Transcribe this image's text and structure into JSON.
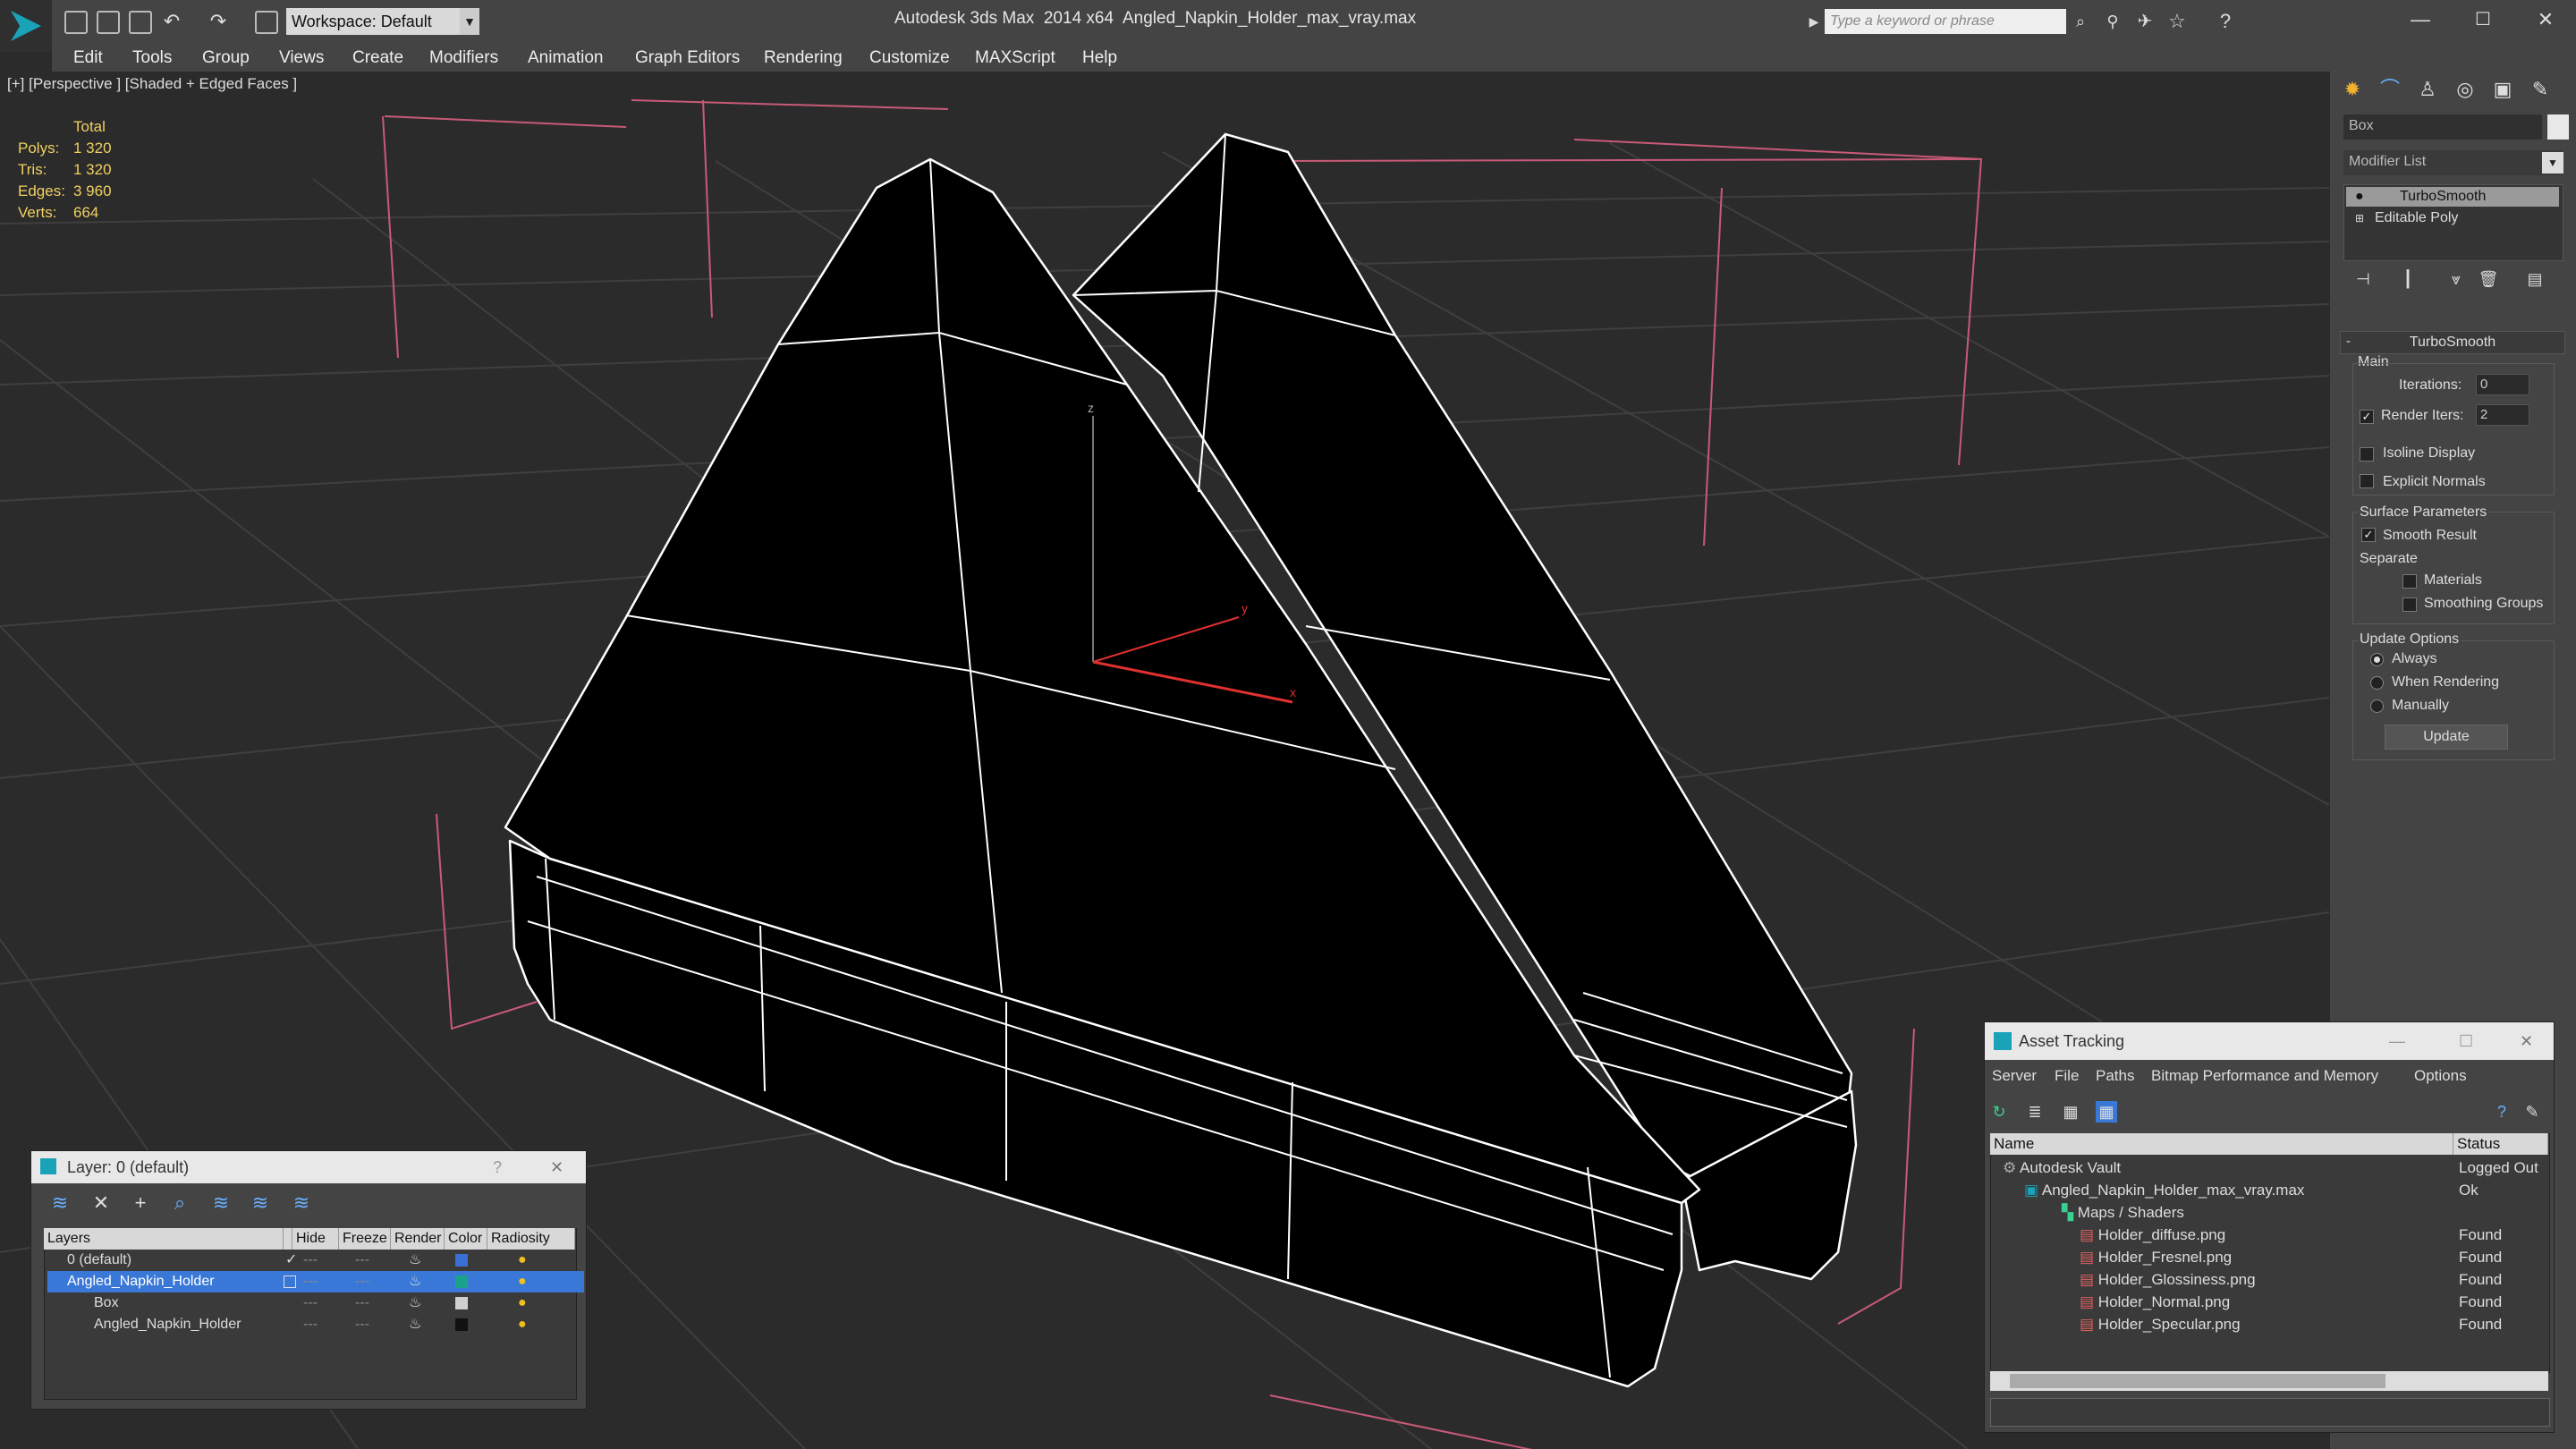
{
  "titlebar": {
    "workspace": "Workspace: Default",
    "app_title": "Autodesk 3ds Max  2014 x64",
    "file_title": "Angled_Napkin_Holder_max_vray.max",
    "search_placeholder": "Type a keyword or phrase"
  },
  "menu": [
    "Edit",
    "Tools",
    "Group",
    "Views",
    "Create",
    "Modifiers",
    "Animation",
    "Graph Editors",
    "Rendering",
    "Customize",
    "MAXScript",
    "Help"
  ],
  "viewport": {
    "label": "[+] [Perspective ] [Shaded + Edged Faces ]",
    "stats_header": "Total",
    "stats": [
      {
        "label": "Polys:",
        "value": "1 320"
      },
      {
        "label": "Tris:",
        "value": "1 320"
      },
      {
        "label": "Edges:",
        "value": "3 960"
      },
      {
        "label": "Verts:",
        "value": "664"
      }
    ],
    "axis": {
      "x": "x",
      "y": "y",
      "z": "z"
    }
  },
  "command_panel": {
    "object_name": "Box",
    "modifier_list": "Modifier List",
    "stack": [
      "TurboSmooth",
      "Editable Poly"
    ],
    "rollout_title": "TurboSmooth",
    "main": "Main",
    "iterations_label": "Iterations:",
    "iterations_value": "0",
    "render_iters_label": "Render Iters:",
    "render_iters_value": "2",
    "isoline": "Isoline Display",
    "explicit_normals": "Explicit Normals",
    "surface_params": "Surface Parameters",
    "smooth_result": "Smooth Result",
    "separate": "Separate",
    "materials": "Materials",
    "smoothing_groups": "Smoothing Groups",
    "update_options": "Update Options",
    "always": "Always",
    "when_rendering": "When Rendering",
    "manually": "Manually",
    "update_button": "Update"
  },
  "layer_dialog": {
    "title": "Layer: 0 (default)",
    "help": "?",
    "close": "✕",
    "columns": [
      "Layers",
      "Hide",
      "Freeze",
      "Render",
      "Color",
      "Radiosity"
    ],
    "rows": [
      {
        "name": "0 (default)",
        "color": "#3a6fd6"
      },
      {
        "name": "Angled_Napkin_Holder",
        "color": "#1aa38a"
      },
      {
        "name": "Box",
        "color": "#cfcfcf"
      },
      {
        "name": "Angled_Napkin_Holder",
        "color": "#111111"
      }
    ]
  },
  "asset_tracking": {
    "title": "Asset Tracking",
    "menu": [
      "Server",
      "File",
      "Paths",
      "Bitmap Performance and Memory",
      "Options"
    ],
    "col_name": "Name",
    "col_status": "Status",
    "rows": [
      {
        "name": "Autodesk Vault",
        "status": "Logged Out"
      },
      {
        "name": "Angled_Napkin_Holder_max_vray.max",
        "status": "Ok"
      },
      {
        "name": "Maps / Shaders",
        "status": ""
      },
      {
        "name": "Holder_diffuse.png",
        "status": "Found"
      },
      {
        "name": "Holder_Fresnel.png",
        "status": "Found"
      },
      {
        "name": "Holder_Glossiness.png",
        "status": "Found"
      },
      {
        "name": "Holder_Normal.png",
        "status": "Found"
      },
      {
        "name": "Holder_Specular.png",
        "status": "Found"
      }
    ]
  }
}
